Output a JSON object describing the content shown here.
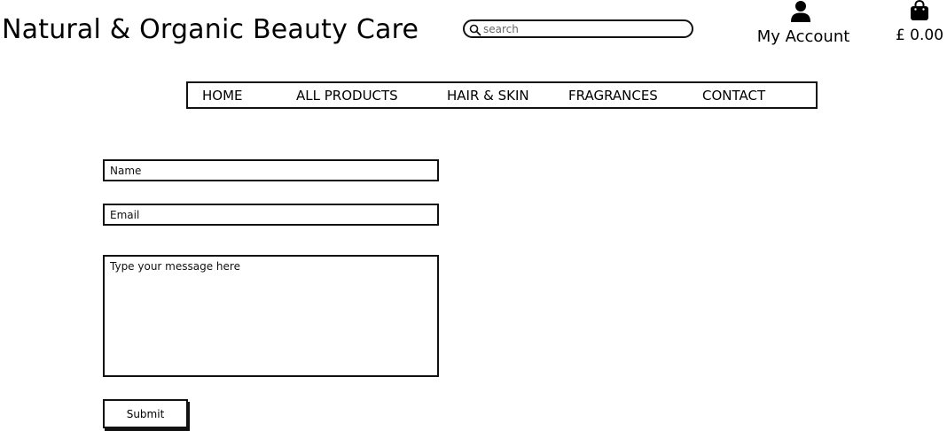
{
  "header": {
    "site_title": "Natural & Organic Beauty Care",
    "search": {
      "placeholder": "search",
      "value": "",
      "icon": "search-icon"
    },
    "account": {
      "label": "My Account",
      "icon": "user-icon"
    },
    "basket": {
      "total": "£ 0.00",
      "icon": "shopping-bag-icon"
    }
  },
  "nav": {
    "items": [
      {
        "label": "HOME"
      },
      {
        "label": "ALL PRODUCTS"
      },
      {
        "label": "HAIR & SKIN"
      },
      {
        "label": "FRAGRANCES"
      },
      {
        "label": "CONTACT"
      }
    ]
  },
  "contact_form": {
    "name": {
      "placeholder": "Name",
      "value": ""
    },
    "email": {
      "placeholder": "Email",
      "value": ""
    },
    "message": {
      "placeholder": "Type your message here",
      "value": ""
    },
    "submit_label": "Submit"
  }
}
